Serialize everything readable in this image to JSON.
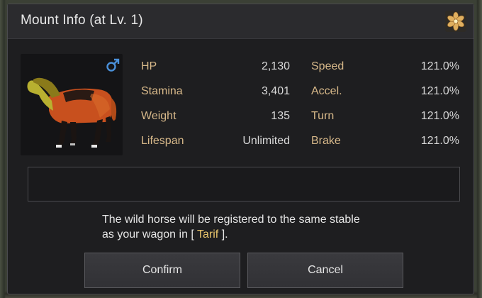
{
  "dialog": {
    "title": "Mount Info (at Lv. 1)",
    "title_icon": "flower-emblem-icon",
    "gender_icon": "male-icon",
    "accent_colors": {
      "label": "#d8b98a",
      "highlight": "#e8c46b",
      "gender": "#4a90d9"
    }
  },
  "stats": {
    "left": [
      {
        "label": "HP",
        "value": "2,130"
      },
      {
        "label": "Stamina",
        "value": "3,401"
      },
      {
        "label": "Weight",
        "value": "135"
      },
      {
        "label": "Lifespan",
        "value": "Unlimited"
      }
    ],
    "right": [
      {
        "label": "Speed",
        "value": "121.0%"
      },
      {
        "label": "Accel.",
        "value": "121.0%"
      },
      {
        "label": "Turn",
        "value": "121.0%"
      },
      {
        "label": "Brake",
        "value": "121.0%"
      }
    ]
  },
  "name_input": {
    "value": "",
    "placeholder": ""
  },
  "message": {
    "line1": "The wild horse will be registered to the same stable",
    "line2_prefix": "as your wagon in [ ",
    "location": "Tarif",
    "line2_suffix": " ]."
  },
  "buttons": {
    "confirm": "Confirm",
    "cancel": "Cancel"
  }
}
